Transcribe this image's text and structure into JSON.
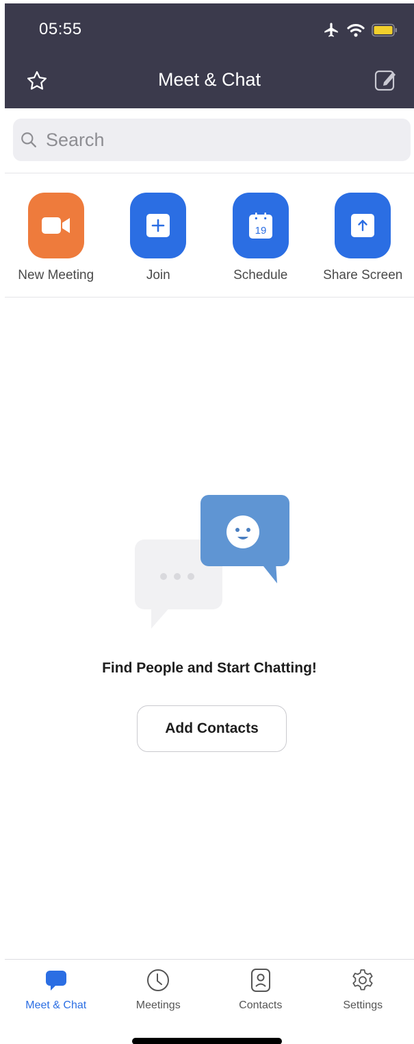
{
  "status_bar": {
    "time": "05:55"
  },
  "nav": {
    "title": "Meet & Chat"
  },
  "search": {
    "placeholder": "Search"
  },
  "actions": [
    {
      "label": "New Meeting",
      "icon": "video-camera-icon",
      "color": "#ee7b3c"
    },
    {
      "label": "Join",
      "icon": "plus-icon",
      "color": "#2b6ee3"
    },
    {
      "label": "Schedule",
      "icon": "calendar-icon",
      "color": "#2b6ee3",
      "calendar_day": "19"
    },
    {
      "label": "Share Screen",
      "icon": "upload-arrow-icon",
      "color": "#2b6ee3"
    }
  ],
  "empty_state": {
    "title": "Find People and Start Chatting!",
    "button_label": "Add Contacts"
  },
  "tabs": [
    {
      "label": "Meet & Chat",
      "icon": "chat-bubble-icon",
      "active": true
    },
    {
      "label": "Meetings",
      "icon": "clock-icon",
      "active": false
    },
    {
      "label": "Contacts",
      "icon": "contact-card-icon",
      "active": false
    },
    {
      "label": "Settings",
      "icon": "gear-icon",
      "active": false
    }
  ],
  "colors": {
    "header": "#3b3a4c",
    "accent": "#2b6ee3",
    "orange": "#ee7b3c"
  }
}
